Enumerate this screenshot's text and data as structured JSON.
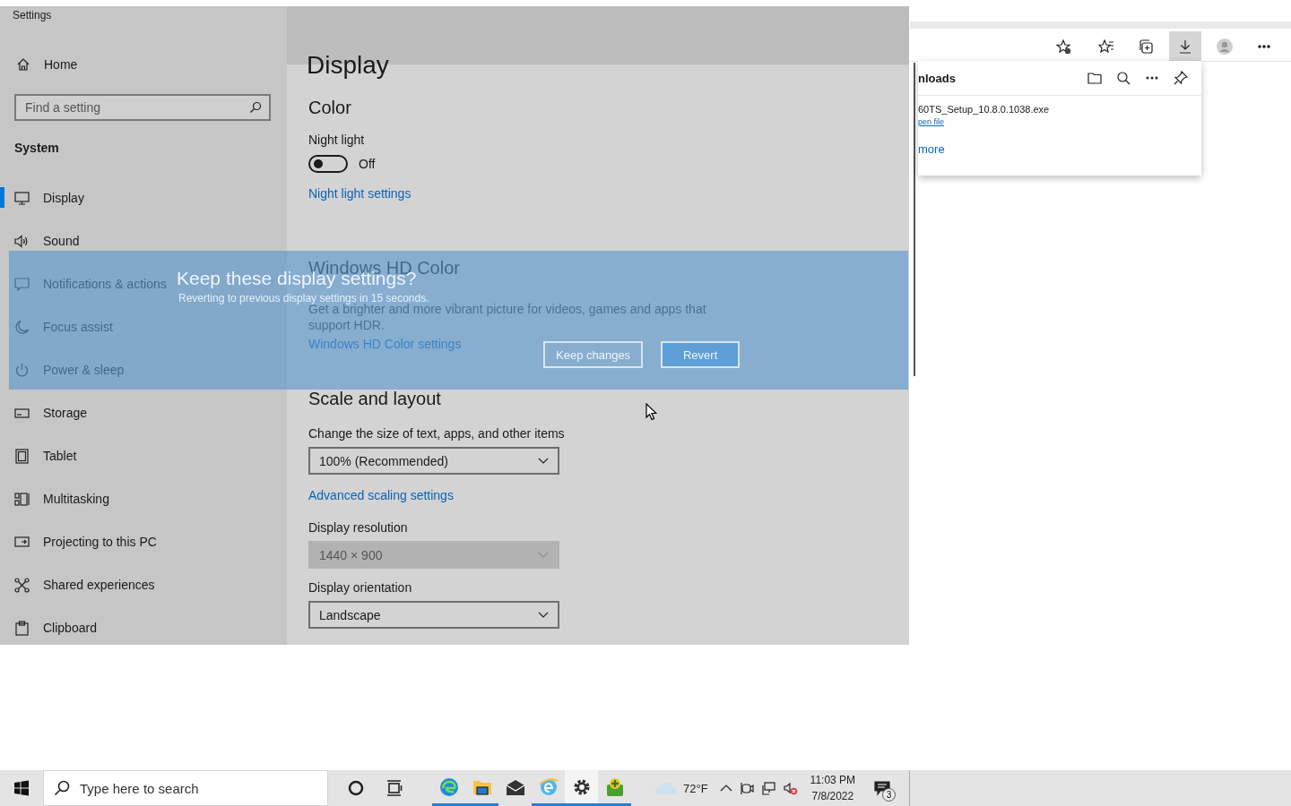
{
  "settings": {
    "title": "Settings",
    "home": "Home",
    "search": {
      "placeholder": "Find a setting"
    },
    "section": "System",
    "nav": [
      {
        "label": "Display",
        "selected": true
      },
      {
        "label": "Sound",
        "selected": false
      },
      {
        "label": "Notifications & actions",
        "selected": false
      },
      {
        "label": "Focus assist",
        "selected": false
      },
      {
        "label": "Power & sleep",
        "selected": false
      },
      {
        "label": "Storage",
        "selected": false
      },
      {
        "label": "Tablet",
        "selected": false
      },
      {
        "label": "Multitasking",
        "selected": false
      },
      {
        "label": "Projecting to this PC",
        "selected": false
      },
      {
        "label": "Shared experiences",
        "selected": false
      },
      {
        "label": "Clipboard",
        "selected": false
      }
    ],
    "page": {
      "title": "Display",
      "color_heading": "Color",
      "night_light": {
        "label": "Night light",
        "on": false,
        "state": "Off",
        "link": "Night light settings"
      },
      "hdr": {
        "heading": "Windows HD Color",
        "description": "Get a brighter and more vibrant picture for videos, games and apps that support HDR.",
        "link": "Windows HD Color settings"
      },
      "scale_heading": "Scale and layout",
      "fields": [
        {
          "label": "Change the size of text, apps, and other items",
          "value": "100% (Recommended)",
          "disabled": false,
          "link": "Advanced scaling settings"
        },
        {
          "label": "Display resolution",
          "value": "1440 × 900",
          "disabled": true
        },
        {
          "label": "Display orientation",
          "value": "Landscape",
          "disabled": false
        }
      ]
    }
  },
  "dialog": {
    "title": "Keep these display settings?",
    "message": "Reverting to previous display settings in 15 seconds.",
    "buttons": [
      {
        "label": "Keep changes",
        "selected": false
      },
      {
        "label": "Revert",
        "selected": true
      }
    ]
  },
  "browser": {
    "toolbar": [
      {
        "selected": false
      },
      {
        "selected": false
      },
      {
        "selected": false
      },
      {
        "selected": true
      },
      {
        "selected": false
      },
      {
        "selected": false
      }
    ],
    "downloads": {
      "title": "nloads",
      "file": "60TS_Setup_10.8.0.1038.exe",
      "action": "pen file",
      "more": "more"
    }
  },
  "taskbar": {
    "search": {
      "placeholder": "Type here to search"
    },
    "apps": [
      {
        "running": true,
        "selected": false
      },
      {
        "running": true,
        "selected": false
      },
      {
        "running": false,
        "selected": false
      },
      {
        "running": true,
        "selected": false
      },
      {
        "running": true,
        "selected": true
      },
      {
        "running": true,
        "selected": false
      }
    ],
    "temperature": "72°F",
    "time": "11:03 PM",
    "date": "7/8/2022",
    "notifications": "3"
  }
}
